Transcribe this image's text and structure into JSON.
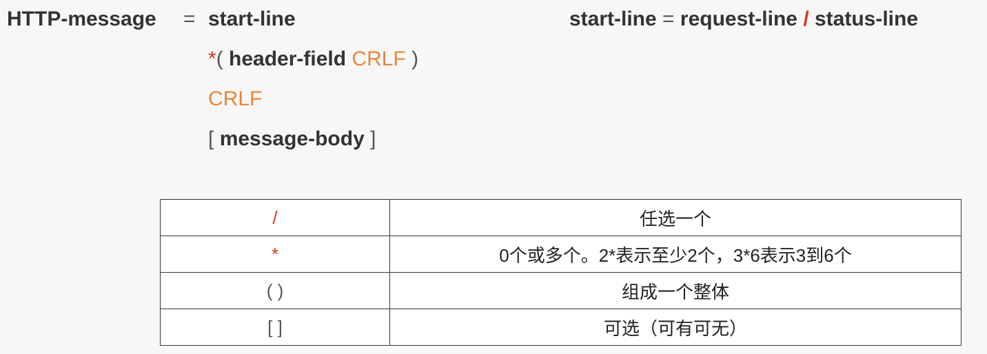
{
  "grammar": {
    "message_name": "HTTP-message",
    "equals": "=",
    "start_line": "start-line",
    "star": "*",
    "open_paren": "(",
    "header_field": "header-field",
    "crlf": "CRLF",
    "close_paren": ")",
    "crlf_line": "CRLF",
    "open_bracket": "[",
    "message_body": "message-body",
    "close_bracket": "]"
  },
  "start_line_rule": {
    "name": "start-line",
    "equals": "=",
    "request_line": "request-line",
    "slash": "/",
    "status_line": "status-line"
  },
  "legend": {
    "rows": [
      {
        "symbol": "/",
        "symbol_color": "red",
        "meaning": "任选一个"
      },
      {
        "symbol": "*",
        "symbol_color": "red",
        "meaning": "0个或多个。2*表示至少2个，3*6表示3到6个"
      },
      {
        "symbol": "( )",
        "symbol_color": "gray",
        "meaning": "组成一个整体"
      },
      {
        "symbol": "[ ]",
        "symbol_color": "gray",
        "meaning": "可选（可有可无）"
      }
    ]
  },
  "colors": {
    "red": "#e0341e",
    "orange": "#e8863a",
    "text": "#333333"
  }
}
